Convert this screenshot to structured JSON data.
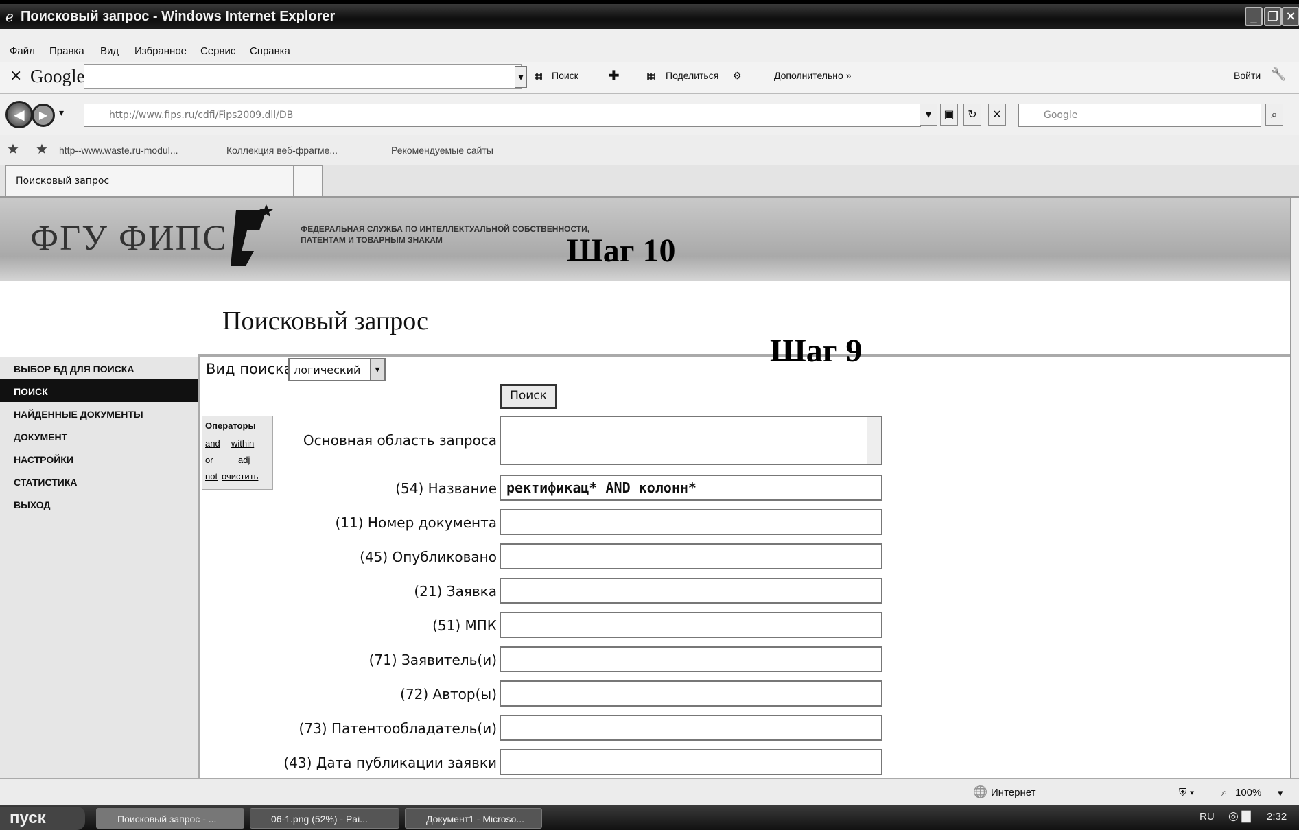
{
  "window": {
    "title": "Поисковый запрос - Windows Internet Explorer"
  },
  "menu": [
    "Файл",
    "Правка",
    "Вид",
    "Избранное",
    "Сервис",
    "Справка"
  ],
  "google_toolbar": {
    "logo": "Google",
    "search_label": "Поиск",
    "share_label": "Поделиться",
    "more_label": "Дополнительно »",
    "signin_label": "Войти"
  },
  "address": {
    "url": "http://www.fips.ru/cdfi/Fips2009.dll/DB",
    "search_placeholder": "Google"
  },
  "favorites": {
    "items": [
      "http--www.waste.ru-modul...",
      "Коллекция веб-фрагме...",
      "Рекомендуемые сайты"
    ]
  },
  "tab": {
    "label": "Поисковый запрос"
  },
  "banner": {
    "logo": "ФГУ ФИПС",
    "subtitle_line1": "ФЕДЕРАЛЬНАЯ СЛУЖБА ПО ИНТЕЛЛЕКТУАЛЬНОЙ СОБСТВЕННОСТИ,",
    "subtitle_line2": "ПАТЕНТАМ И ТОВАРНЫМ ЗНАКАМ"
  },
  "annotations": {
    "step10": "Шаг 10",
    "step9": "Шаг 9"
  },
  "page_title": "Поисковый запрос",
  "sidenav": [
    "ВЫБОР БД ДЛЯ ПОИСКА",
    "ПОИСК",
    "НАЙДЕННЫЕ ДОКУМЕНТЫ",
    "ДОКУМЕНТ",
    "НАСТРОЙКИ",
    "СТАТИСТИКА",
    "ВЫХОД"
  ],
  "search": {
    "type_label": "Вид поиска",
    "type_value": "логический",
    "button": "Поиск"
  },
  "operators": {
    "title": "Операторы",
    "and": "and",
    "within": "within",
    "or": "or",
    "adj": "adj",
    "not": "not",
    "clear": "очистить"
  },
  "fields": [
    {
      "label": "Основная область запроса",
      "value": ""
    },
    {
      "label": "(54) Название",
      "value": "ректификац* AND колонн*"
    },
    {
      "label": "(11) Номер документа",
      "value": ""
    },
    {
      "label": "(45) Опубликовано",
      "value": ""
    },
    {
      "label": "(21) Заявка",
      "value": ""
    },
    {
      "label": "(51) МПК",
      "value": ""
    },
    {
      "label": "(71) Заявитель(и)",
      "value": ""
    },
    {
      "label": "(72) Автор(ы)",
      "value": ""
    },
    {
      "label": "(73) Патентообладатель(и)",
      "value": ""
    },
    {
      "label": "(43) Дата публикации заявки",
      "value": ""
    }
  ],
  "status": {
    "zone": "Интернет",
    "zoom": "100%"
  },
  "taskbar": {
    "start": "пуск",
    "buttons": [
      "Поисковый запрос - ...",
      "06-1.png (52%) - Pai...",
      "Документ1 - Microso..."
    ],
    "lang": "RU",
    "clock": "2:32"
  }
}
